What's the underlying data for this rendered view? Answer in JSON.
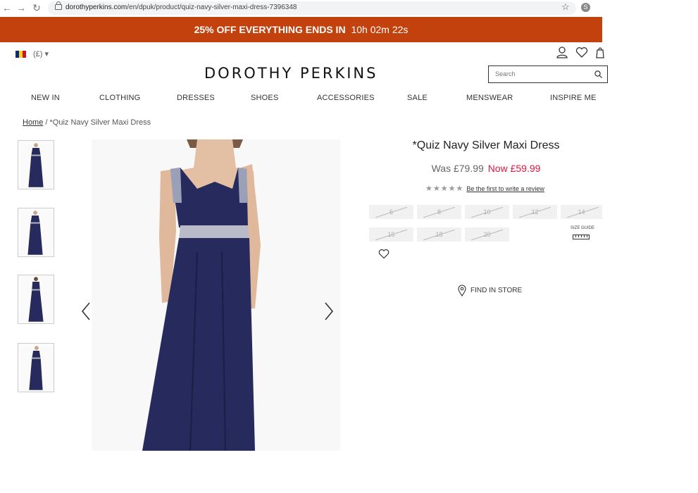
{
  "browser": {
    "url_host": "dorothyperkins.com",
    "url_path": "/en/dpuk/product/quiz-navy-silver-maxi-dress-7396348",
    "ext_label": "S"
  },
  "promo": {
    "text": "25% OFF EVERYTHING ENDS IN",
    "countdown": "10h 02m 22s",
    "background": "#c2410c"
  },
  "locale": {
    "currency": "(£) ▾"
  },
  "header": {
    "logo": "DOROTHY PERKINS",
    "search_placeholder": "Search"
  },
  "nav": {
    "items": [
      "NEW IN",
      "CLOTHING",
      "DRESSES",
      "SHOES",
      "ACCESSORIES",
      "SALE",
      "MENSWEAR",
      "INSPIRE ME"
    ]
  },
  "breadcrumb": {
    "home": "Home",
    "separator": " / ",
    "current": "*Quiz Navy Silver Maxi Dress"
  },
  "product": {
    "title": "*Quiz Navy Silver Maxi Dress",
    "was_price": "Was £79.99",
    "now_price": "Now £59.99",
    "rating_stars": 0,
    "review_cta": "Be the first to write a review",
    "sizes": [
      "6",
      "8",
      "10",
      "12",
      "14",
      "16",
      "18",
      "20"
    ],
    "size_guide_label": "SIZE GUIDE",
    "find_in_store": "FIND IN STORE",
    "dress_color": "#262a5c",
    "accent_price_color": "#e0173f"
  }
}
